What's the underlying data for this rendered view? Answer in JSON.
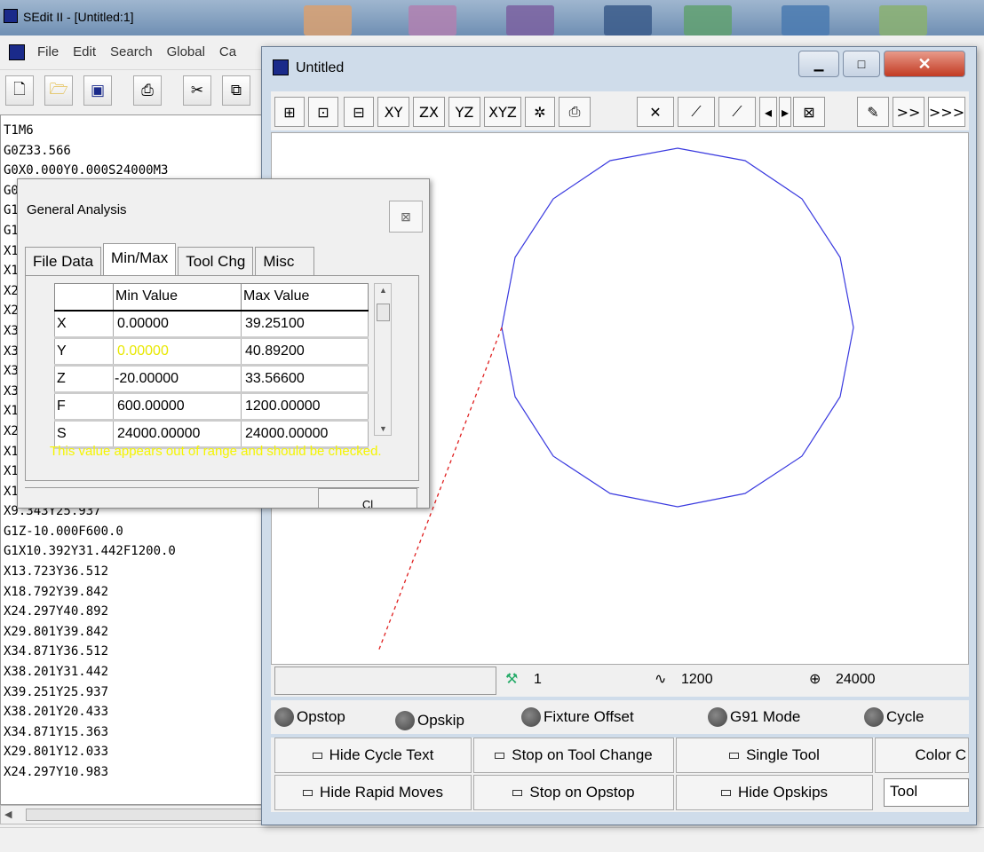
{
  "main_window": {
    "title": "SEdit II - [Untitled:1]",
    "menu": [
      "File",
      "Edit",
      "Search",
      "Global",
      "Ca"
    ]
  },
  "code_lines": [
    "T1M6",
    "G0Z33.566",
    "G0X0.000Y0.000S24000M3",
    "G0",
    "G1",
    "G1",
    "X1",
    "X1",
    "X2",
    "X2",
    "X3",
    "X3",
    "X3",
    "X3",
    "X1",
    "X2",
    "X1",
    "X1",
    "X10.392Y20.433",
    "X9.343Y25.937",
    "G1Z-10.000F600.0",
    "G1X10.392Y31.442F1200.0",
    "X13.723Y36.512",
    "X18.792Y39.842",
    "X24.297Y40.892",
    "X29.801Y39.842",
    "X34.871Y36.512",
    "X38.201Y31.442",
    "X39.251Y25.937",
    "X38.201Y20.433",
    "X34.871Y15.363",
    "X29.801Y12.033",
    "X24.297Y10.983"
  ],
  "analysis_dialog": {
    "title": "General Analysis",
    "tabs": [
      "File Data",
      "Min/Max",
      "Tool Chg",
      "Misc"
    ],
    "active_tab": "Min/Max",
    "columns": [
      "",
      "Min Value",
      "Max Value"
    ],
    "rows": [
      {
        "label": "X",
        "min": "0.00000",
        "max": "39.25100"
      },
      {
        "label": "Y",
        "min": "0.00000",
        "max": "40.89200"
      },
      {
        "label": "Z",
        "min": "-20.00000",
        "max": "33.56600"
      },
      {
        "label": "F",
        "min": "600.00000",
        "max": "1200.00000"
      },
      {
        "label": "S",
        "min": "24000.00000",
        "max": "24000.00000"
      }
    ],
    "warning": "This value appears out of range and should be checked.",
    "bottom_button": "Cl"
  },
  "plot_window": {
    "title": "Untitled",
    "toolbar": [
      "XY",
      "ZX",
      "YZ",
      "XYZ"
    ],
    "more_labels": [
      ">>",
      ">>>"
    ],
    "readouts": {
      "tool": "1",
      "feed": "1200",
      "speed": "24000"
    },
    "radios": [
      "Opstop",
      "Opskip",
      "Fixture Offset",
      "G91 Mode",
      "Cycle"
    ],
    "buttons_row1": [
      "Hide Cycle Text",
      "Stop on Tool Change",
      "Single Tool",
      "Color C"
    ],
    "buttons_row2": [
      "Hide Rapid Moves",
      "Stop on Opstop",
      "Hide Opskips"
    ],
    "color_select": "Tool",
    "colors": {
      "feed_path": "#3a3adf",
      "rapid_path": "#e02020"
    }
  }
}
